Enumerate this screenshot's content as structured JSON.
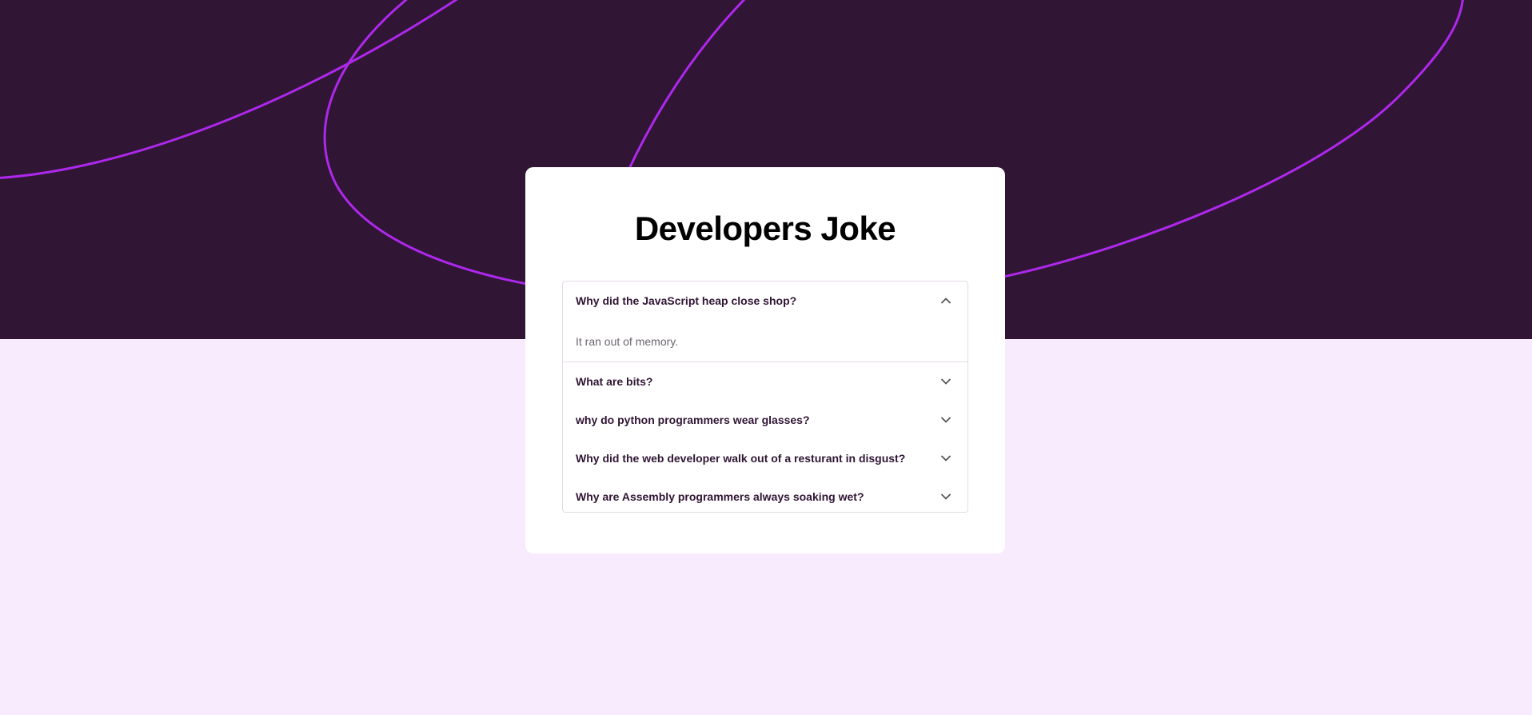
{
  "colors": {
    "hero_background": "#301534",
    "page_background": "#f9ebfe",
    "accent_line": "#ad28eb",
    "card_background": "#ffffff"
  },
  "card": {
    "title": "Developers Joke"
  },
  "faq": [
    {
      "question": "Why did the JavaScript heap close shop?",
      "answer": "It ran out of memory.",
      "expanded": true,
      "icon": "chevron-up-icon"
    },
    {
      "question": "What are bits?",
      "expanded": false,
      "icon": "chevron-down-icon"
    },
    {
      "question": "why do python programmers wear glasses?",
      "expanded": false,
      "icon": "chevron-down-icon"
    },
    {
      "question": "Why did the web developer walk out of a resturant in disgust?",
      "expanded": false,
      "icon": "chevron-down-icon"
    },
    {
      "question": "Why are Assembly programmers always soaking wet?",
      "expanded": false,
      "icon": "chevron-down-icon"
    }
  ]
}
